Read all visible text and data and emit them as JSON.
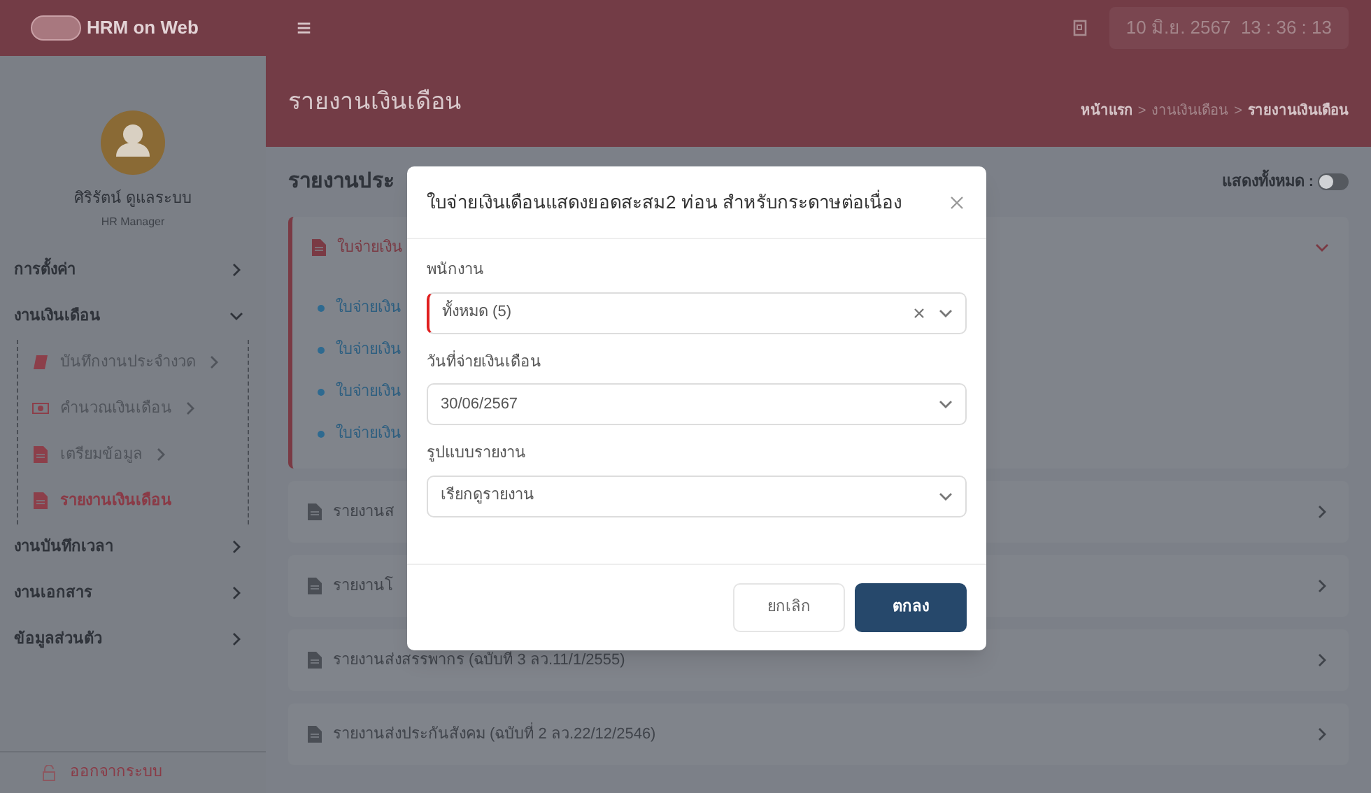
{
  "topbar": {
    "logo_text": "HRM on Web",
    "menu_icon": "≡",
    "datetime": "10 มิ.ย. 2567  13 : 36 : 13"
  },
  "sidebar": {
    "user_name": "ศิริรัตน์ ดูแลระบบ",
    "user_role": "HR Manager",
    "items": [
      {
        "label": "การตั้งค่า",
        "expanded": false,
        "selected": false
      },
      {
        "label": "งานเงินเดือน",
        "expanded": true,
        "selected": false,
        "children": [
          {
            "label": "บันทึกงานประจำงวด",
            "kind": "book",
            "has_arrow": true,
            "selected": false
          },
          {
            "label": "คำนวณเงินเดือน",
            "kind": "money",
            "has_arrow": true,
            "selected": false
          },
          {
            "label": "เตรียมข้อมูล",
            "kind": "file",
            "has_arrow": true,
            "selected": false
          },
          {
            "label": "รายงานเงินเดือน",
            "kind": "file",
            "has_arrow": false,
            "selected": true
          }
        ]
      },
      {
        "label": "งานบันทึกเวลา",
        "expanded": false,
        "selected": false
      },
      {
        "label": "งานเอกสาร",
        "expanded": false,
        "selected": false
      },
      {
        "label": "ข้อมูลส่วนตัว",
        "expanded": false,
        "selected": false
      }
    ],
    "logout": "ออกจากระบบ"
  },
  "page_header": {
    "title": "รายงานเงินเดือน",
    "breadcrumb_separators": [
      ">",
      ">"
    ],
    "breadcrumb": [
      {
        "label": "หน้าแรก",
        "bold": true
      },
      {
        "label": "งานเงินเดือน",
        "bold": false
      },
      {
        "label": "รายงานเงินเดือน",
        "bold": true
      }
    ]
  },
  "section": {
    "title": "รายงานประ",
    "show_all_label": "แสดงทั้งหมด :",
    "show_all_on": false
  },
  "cards": [
    {
      "label": "ใบจ่ายเงิน",
      "expanded": true,
      "items": [
        "ใบจ่ายเงิน",
        "ใบจ่ายเงิน",
        "ใบจ่ายเงิน",
        "ใบจ่ายเงิน"
      ]
    },
    {
      "label": "รายงานส",
      "expanded": false
    },
    {
      "label": "รายงานโ",
      "expanded": false
    },
    {
      "label": "รายงานส่งสรรพากร (ฉบับที่ 3 ลว.11/1/2555)",
      "expanded": false
    },
    {
      "label": "รายงานส่งประกันสังคม (ฉบับที่ 2 ลว.22/12/2546)",
      "expanded": false
    }
  ],
  "modal": {
    "title": "ใบจ่ายเงินเดือนแสดงยอดสะสม2 ท่อน สำหรับกระดาษต่อเนื่อง",
    "fields": [
      {
        "label": "พนักงาน",
        "value": "ทั้งหมด (5)",
        "clearable": true,
        "required": true
      },
      {
        "label": "วันที่จ่ายเงินเดือน",
        "value": "30/06/2567",
        "clearable": false,
        "required": false
      },
      {
        "label": "รูปแบบรายงาน",
        "value": "เรียกดูรายงาน",
        "clearable": false,
        "required": false
      }
    ],
    "buttons": [
      {
        "label": "ยกเลิก",
        "kind": "secondary"
      },
      {
        "label": "ตกลง",
        "kind": "primary"
      }
    ]
  }
}
